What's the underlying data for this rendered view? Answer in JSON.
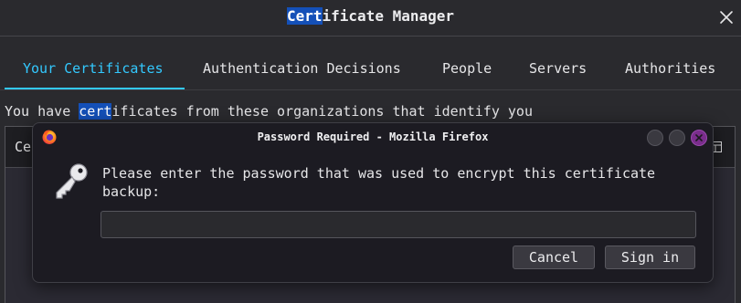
{
  "window": {
    "title_highlight": "Cert",
    "title_rest": "ificate Manager"
  },
  "tabs": [
    {
      "label": "Your Certificates",
      "active": true
    },
    {
      "label": "Authentication Decisions",
      "active": false
    },
    {
      "label": "People",
      "active": false
    },
    {
      "label": "Servers",
      "active": false
    },
    {
      "label": "Authorities",
      "active": false
    }
  ],
  "description": {
    "before": "You have ",
    "highlight": "cert",
    "after": "ificates from these organizations that identify you"
  },
  "table": {
    "column_header": "Ce"
  },
  "dialog": {
    "title": "Password Required - Mozilla Firefox",
    "message": "Please enter the password that was used to encrypt this certificate backup:",
    "password_value": "",
    "cancel_label": "Cancel",
    "signin_label": "Sign in"
  },
  "colors": {
    "accent": "#33c9ff",
    "highlight": "#1450b8",
    "window_bg": "#2a2a2e",
    "dialog_bg": "#1c1b22",
    "close_button": "#7a2d8c"
  },
  "icons": [
    "close-icon",
    "firefox-icon",
    "minimize-icon",
    "maximize-icon",
    "dialog-close-icon",
    "key-icon",
    "column-picker-icon"
  ]
}
